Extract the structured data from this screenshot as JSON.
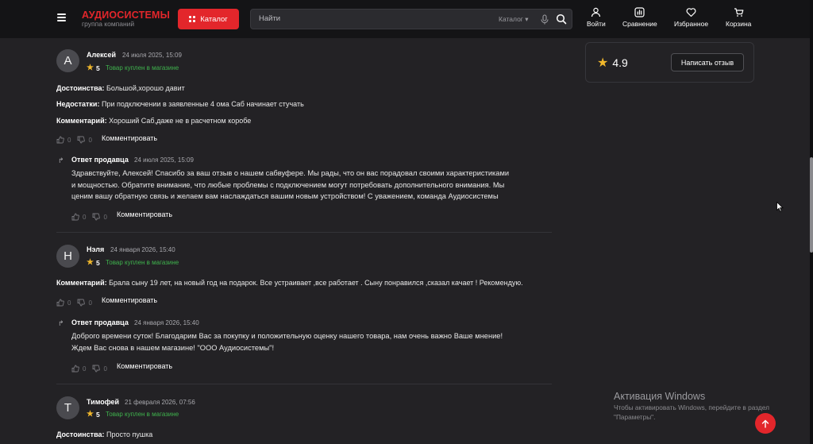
{
  "header": {
    "logo_title": "АУДИОСИСТЕМЫ",
    "logo_sub": "группа компаний",
    "catalog_label": "Каталог",
    "search_placeholder": "Найти",
    "search_category": "Каталог",
    "nav": {
      "login": "Войти",
      "compare": "Сравнение",
      "favorites": "Избранное",
      "cart": "Корзина"
    }
  },
  "reviews": [
    {
      "avatar_letter": "А",
      "name": "Алексей",
      "date": "24 июля 2025, 15:09",
      "rating": "5",
      "bought": "Товар куплен в магазине",
      "lines": [
        {
          "label": "Достоинства:",
          "text": " Большой,хорошо давит"
        },
        {
          "label": "Недостатки:",
          "text": " При подключении в заявленные 4 ома Саб начинает стучать"
        },
        {
          "label": "Комментарий:",
          "text": " Хороший Саб,даже не в расчетном коробе"
        }
      ],
      "likes": "0",
      "dislikes": "0",
      "comment_label": "Комментировать",
      "reply": {
        "title": "Ответ продавца",
        "date": "24 июля 2025, 15:09",
        "text_lines": [
          "Здравствуйте, Алексей! Спасибо за ваш отзыв о нашем сабвуфере. Мы рады, что он вас порадовал своими характеристиками",
          "и мощностью. Обратите внимание, что любые проблемы с подключением могут потребовать дополнительного внимания. Мы",
          "ценим вашу обратную связь и желаем вам наслаждаться вашим новым устройством! С уважением, команда Аудиосистемы"
        ],
        "likes": "0",
        "dislikes": "0",
        "comment_label": "Комментировать"
      }
    },
    {
      "avatar_letter": "Н",
      "name": "Нэля",
      "date": "24 января 2026, 15:40",
      "rating": "5",
      "bought": "Товар куплен в магазине",
      "lines": [
        {
          "label": "Комментарий:",
          "text": " Брала сыну 19 лет, на новый год на подарок. Все устраивает ,все работает . Сыну понравился ,сказал качает ! Рекомендую."
        }
      ],
      "likes": "0",
      "dislikes": "0",
      "comment_label": "Комментировать",
      "reply": {
        "title": "Ответ продавца",
        "date": "24 января 2026, 15:40",
        "text_lines": [
          "Доброго времени суток! Благодарим Вас за покупку и положительную оценку нашего товара, нам очень важно Ваше мнение!",
          "Ждем Вас снова в нашем магазине! \"ООО Аудиосистемы\"!"
        ],
        "likes": "0",
        "dislikes": "0",
        "comment_label": "Комментировать"
      }
    },
    {
      "avatar_letter": "Т",
      "name": "Тимофей",
      "date": "21 февраля 2026, 07:56",
      "rating": "5",
      "bought": "Товар куплен в магазине",
      "lines": [
        {
          "label": "Достоинства:",
          "text": " Просто пушка"
        }
      ]
    }
  ],
  "rating_panel": {
    "value": "4.9",
    "write_review": "Написать отзыв"
  },
  "windows_notice": {
    "title": "Активация Windows",
    "line1": "Чтобы активировать Windows, перейдите в раздел",
    "line2": "\"Параметры\"."
  },
  "colors": {
    "accent": "#e3262b",
    "bought": "#3fb24d",
    "star": "#f1b82c"
  }
}
